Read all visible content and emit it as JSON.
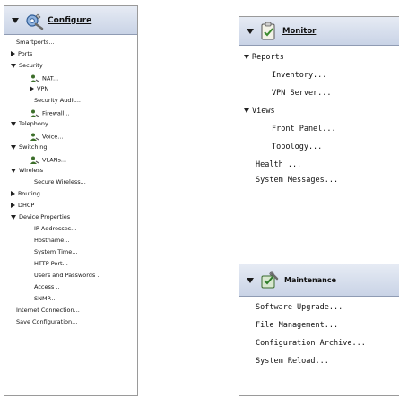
{
  "configure": {
    "title": "Configure",
    "items": {
      "smartports": "Smartports...",
      "ports": "Ports",
      "security": "Security",
      "nat": "NAT...",
      "vpn": "VPN",
      "security_audit": "Security Audit...",
      "firewall": "Firewall...",
      "telephony": "Telephony",
      "voice": "Voice...",
      "switching": "Switching",
      "vlans": "VLANs...",
      "wireless": "Wireless",
      "secure_wireless": "Secure Wireless...",
      "routing": "Routing",
      "dhcp": "DHCP",
      "device_properties": "Device Properties",
      "ip_addresses": "IP Addresses...",
      "hostname": "Hostname...",
      "system_time": "System Time...",
      "http_port": "HTTP Port...",
      "users_passwords": "Users and Passwords ..",
      "access": "Access ..",
      "snmp": "SNMP...",
      "internet_connection": "Internet Connection...",
      "save_configuration": "Save Configuration..."
    }
  },
  "monitor": {
    "title": "Monitor",
    "items": {
      "reports": "Reports",
      "inventory": "Inventory...",
      "vpn_server": "VPN Server...",
      "views": "Views",
      "front_panel": "Front Panel...",
      "topology": "Topology...",
      "health": "Health ...",
      "system_messages": "System Messages..."
    }
  },
  "maintenance": {
    "title": "Maintenance",
    "items": {
      "software_upgrade": "Software Upgrade...",
      "file_management": "File Management...",
      "configuration_archive": "Configuration Archive...",
      "system_reload": "System Reload..."
    }
  },
  "icons": {
    "configure": "wrench-gear-icon",
    "monitor": "clipboard-check-icon",
    "maintenance": "maintenance-tools-icon",
    "item": "person-icon"
  },
  "colors": {
    "header_gradient_top": "#e6ebf4",
    "header_gradient_bottom": "#c9d3e6",
    "border": "#9a9a9a"
  }
}
